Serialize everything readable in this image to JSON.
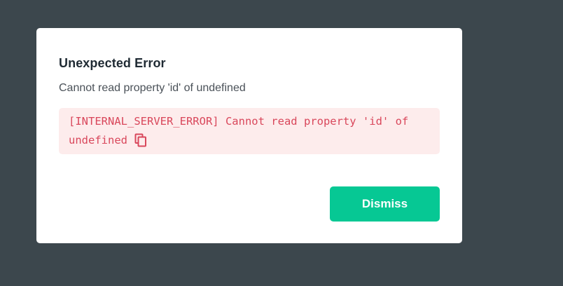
{
  "dialog": {
    "title": "Unexpected Error",
    "message": "Cannot read property 'id' of undefined",
    "error_detail": "[INTERNAL_SERVER_ERROR] Cannot read property 'id' of undefined",
    "copy_icon": "copy-icon",
    "dismiss_label": "Dismiss"
  },
  "colors": {
    "backdrop": "#3c474d",
    "dialog_background": "#ffffff",
    "error_background": "#fdecec",
    "error_text": "#d9475b",
    "accent": "#06c894"
  }
}
